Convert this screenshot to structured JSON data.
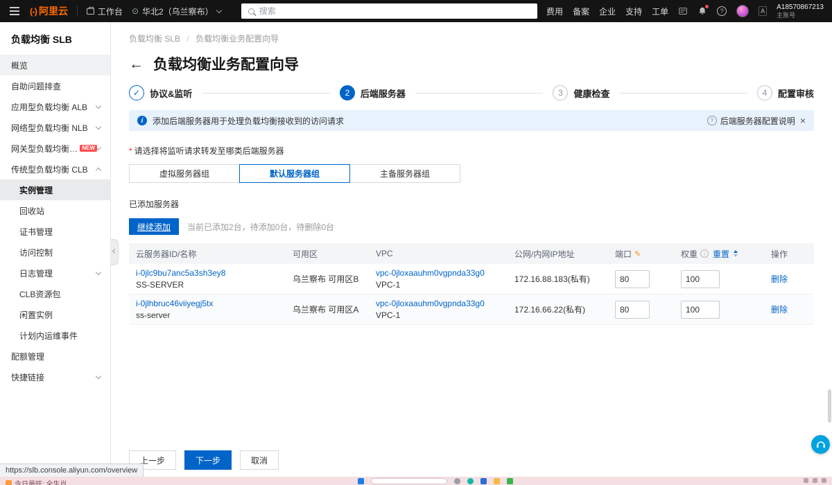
{
  "icons": {
    "logo_mark": "(-)",
    "pin": "⊙",
    "back_arrow": "←",
    "info": "i",
    "help": "?",
    "close": "×",
    "pencil": "✎"
  },
  "topbar": {
    "logo_text": "阿里云",
    "workbench": "工作台",
    "region": "华北2（乌兰察布）",
    "search_placeholder": "搜索",
    "links": [
      "费用",
      "备案",
      "企业",
      "支持",
      "工单"
    ],
    "account_id": "A18570867213",
    "account_role": "主账号"
  },
  "sidebar": {
    "title": "负载均衡 SLB",
    "items": [
      {
        "label": "概览"
      },
      {
        "label": "自助问题排查"
      },
      {
        "label": "应用型负载均衡 ALB"
      },
      {
        "label": "网络型负载均衡 NLB"
      },
      {
        "label": "网关型负载均衡 GWLB",
        "badge": "NEW"
      },
      {
        "label": "传统型负载均衡 CLB"
      },
      {
        "label": "实例管理"
      },
      {
        "label": "回收站"
      },
      {
        "label": "证书管理"
      },
      {
        "label": "访问控制"
      },
      {
        "label": "日志管理"
      },
      {
        "label": "CLB资源包"
      },
      {
        "label": "闲置实例"
      },
      {
        "label": "计划内运维事件"
      },
      {
        "label": "配额管理"
      },
      {
        "label": "快捷链接"
      }
    ]
  },
  "breadcrumb": {
    "root": "负载均衡 SLB",
    "sep": "/",
    "current": "负载均衡业务配置向导"
  },
  "wizard": {
    "title": "负载均衡业务配置向导",
    "steps": [
      {
        "num": "✓",
        "label": "协议&监听"
      },
      {
        "num": "2",
        "label": "后端服务器"
      },
      {
        "num": "3",
        "label": "健康检查"
      },
      {
        "num": "4",
        "label": "配置审核"
      }
    ],
    "banner": {
      "text": "添加后端服务器用于处理负载均衡接收到的访问请求",
      "help_link": "后端服务器配置说明"
    },
    "required_mark": "*",
    "select_label": "请选择将监听请求转发至哪类后端服务器",
    "group_tabs": [
      "虚拟服务器组",
      "默认服务器组",
      "主备服务器组"
    ],
    "added_title": "已添加服务器",
    "continue_add": "继续添加",
    "add_summary": "当前已添加2台，待添加0台，待删除0台",
    "table": {
      "headers": {
        "id": "云服务器ID/名称",
        "zone": "可用区",
        "vpc": "VPC",
        "ip": "公网/内网IP地址",
        "port": "端口",
        "weight": "权重",
        "reset": "重置",
        "action": "操作"
      },
      "rows": [
        {
          "id": "i-0jlc9bu7anc5a3sh3ey8",
          "name": "SS-SERVER",
          "zone": "乌兰察布 可用区B",
          "vpc_id": "vpc-0jloxaauhm0vgpnda33g0",
          "vpc_name": "VPC-1",
          "ip": "172.16.88.183(私有)",
          "port": "80",
          "weight": "100",
          "action": "删除"
        },
        {
          "id": "i-0jlhbruc46viiyegj5tx",
          "name": "ss-server",
          "zone": "乌兰察布 可用区A",
          "vpc_id": "vpc-0jloxaauhm0vgpnda33g0",
          "vpc_name": "VPC-1",
          "ip": "172.16.66.22(私有)",
          "port": "80",
          "weight": "100",
          "action": "删除"
        }
      ]
    },
    "footer": {
      "prev": "上一步",
      "next": "下一步",
      "cancel": "取消"
    }
  },
  "status_url": "https://slb.console.aliyun.com/overview",
  "taskbar": {
    "news": "今日最旺: 全生肖"
  }
}
